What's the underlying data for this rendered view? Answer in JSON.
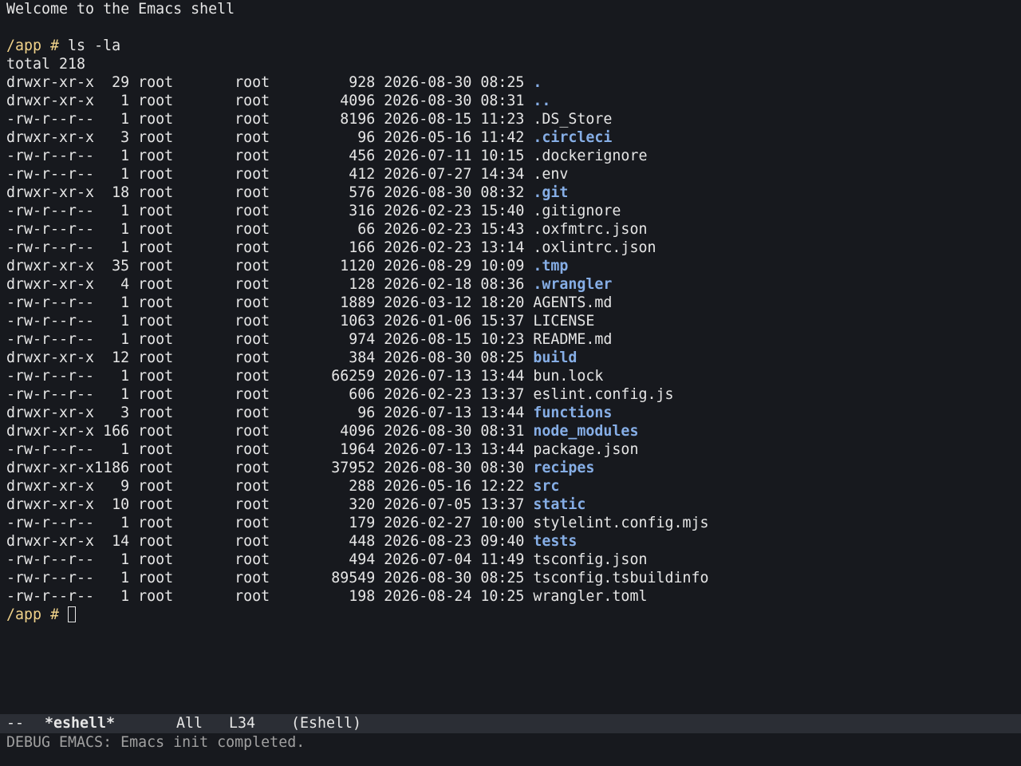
{
  "welcome": "Welcome to the Emacs shell",
  "prompt": "/app # ",
  "command": "ls -la",
  "total": "total 218",
  "entries": [
    {
      "perms": "drwxr-xr-x",
      "links": "  29",
      "owner": "root",
      "group": "root",
      "size": "928",
      "date": "2026-08-30 08:25",
      "name": ".",
      "is_dir": true
    },
    {
      "perms": "drwxr-xr-x",
      "links": "   1",
      "owner": "root",
      "group": "root",
      "size": "4096",
      "date": "2026-08-30 08:31",
      "name": "..",
      "is_dir": true
    },
    {
      "perms": "-rw-r--r--",
      "links": "   1",
      "owner": "root",
      "group": "root",
      "size": "8196",
      "date": "2026-08-15 11:23",
      "name": ".DS_Store",
      "is_dir": false
    },
    {
      "perms": "drwxr-xr-x",
      "links": "   3",
      "owner": "root",
      "group": "root",
      "size": "96",
      "date": "2026-05-16 11:42",
      "name": ".circleci",
      "is_dir": true
    },
    {
      "perms": "-rw-r--r--",
      "links": "   1",
      "owner": "root",
      "group": "root",
      "size": "456",
      "date": "2026-07-11 10:15",
      "name": ".dockerignore",
      "is_dir": false
    },
    {
      "perms": "-rw-r--r--",
      "links": "   1",
      "owner": "root",
      "group": "root",
      "size": "412",
      "date": "2026-07-27 14:34",
      "name": ".env",
      "is_dir": false
    },
    {
      "perms": "drwxr-xr-x",
      "links": "  18",
      "owner": "root",
      "group": "root",
      "size": "576",
      "date": "2026-08-30 08:32",
      "name": ".git",
      "is_dir": true
    },
    {
      "perms": "-rw-r--r--",
      "links": "   1",
      "owner": "root",
      "group": "root",
      "size": "316",
      "date": "2026-02-23 15:40",
      "name": ".gitignore",
      "is_dir": false
    },
    {
      "perms": "-rw-r--r--",
      "links": "   1",
      "owner": "root",
      "group": "root",
      "size": "66",
      "date": "2026-02-23 15:43",
      "name": ".oxfmtrc.json",
      "is_dir": false
    },
    {
      "perms": "-rw-r--r--",
      "links": "   1",
      "owner": "root",
      "group": "root",
      "size": "166",
      "date": "2026-02-23 13:14",
      "name": ".oxlintrc.json",
      "is_dir": false
    },
    {
      "perms": "drwxr-xr-x",
      "links": "  35",
      "owner": "root",
      "group": "root",
      "size": "1120",
      "date": "2026-08-29 10:09",
      "name": ".tmp",
      "is_dir": true
    },
    {
      "perms": "drwxr-xr-x",
      "links": "   4",
      "owner": "root",
      "group": "root",
      "size": "128",
      "date": "2026-02-18 08:36",
      "name": ".wrangler",
      "is_dir": true
    },
    {
      "perms": "-rw-r--r--",
      "links": "   1",
      "owner": "root",
      "group": "root",
      "size": "1889",
      "date": "2026-03-12 18:20",
      "name": "AGENTS.md",
      "is_dir": false
    },
    {
      "perms": "-rw-r--r--",
      "links": "   1",
      "owner": "root",
      "group": "root",
      "size": "1063",
      "date": "2026-01-06 15:37",
      "name": "LICENSE",
      "is_dir": false
    },
    {
      "perms": "-rw-r--r--",
      "links": "   1",
      "owner": "root",
      "group": "root",
      "size": "974",
      "date": "2026-08-15 10:23",
      "name": "README.md",
      "is_dir": false
    },
    {
      "perms": "drwxr-xr-x",
      "links": "  12",
      "owner": "root",
      "group": "root",
      "size": "384",
      "date": "2026-08-30 08:25",
      "name": "build",
      "is_dir": true
    },
    {
      "perms": "-rw-r--r--",
      "links": "   1",
      "owner": "root",
      "group": "root",
      "size": "66259",
      "date": "2026-07-13 13:44",
      "name": "bun.lock",
      "is_dir": false
    },
    {
      "perms": "-rw-r--r--",
      "links": "   1",
      "owner": "root",
      "group": "root",
      "size": "606",
      "date": "2026-02-23 13:37",
      "name": "eslint.config.js",
      "is_dir": false
    },
    {
      "perms": "drwxr-xr-x",
      "links": "   3",
      "owner": "root",
      "group": "root",
      "size": "96",
      "date": "2026-07-13 13:44",
      "name": "functions",
      "is_dir": true
    },
    {
      "perms": "drwxr-xr-x",
      "links": " 166",
      "owner": "root",
      "group": "root",
      "size": "4096",
      "date": "2026-08-30 08:31",
      "name": "node_modules",
      "is_dir": true
    },
    {
      "perms": "-rw-r--r--",
      "links": "   1",
      "owner": "root",
      "group": "root",
      "size": "1964",
      "date": "2026-07-13 13:44",
      "name": "package.json",
      "is_dir": false
    },
    {
      "perms": "drwxr-xr-x",
      "links": "1186",
      "owner": "root",
      "group": "root",
      "size": "37952",
      "date": "2026-08-30 08:30",
      "name": "recipes",
      "is_dir": true
    },
    {
      "perms": "drwxr-xr-x",
      "links": "   9",
      "owner": "root",
      "group": "root",
      "size": "288",
      "date": "2026-05-16 12:22",
      "name": "src",
      "is_dir": true
    },
    {
      "perms": "drwxr-xr-x",
      "links": "  10",
      "owner": "root",
      "group": "root",
      "size": "320",
      "date": "2026-07-05 13:37",
      "name": "static",
      "is_dir": true
    },
    {
      "perms": "-rw-r--r--",
      "links": "   1",
      "owner": "root",
      "group": "root",
      "size": "179",
      "date": "2026-02-27 10:00",
      "name": "stylelint.config.mjs",
      "is_dir": false
    },
    {
      "perms": "drwxr-xr-x",
      "links": "  14",
      "owner": "root",
      "group": "root",
      "size": "448",
      "date": "2026-08-23 09:40",
      "name": "tests",
      "is_dir": true
    },
    {
      "perms": "-rw-r--r--",
      "links": "   1",
      "owner": "root",
      "group": "root",
      "size": "494",
      "date": "2026-07-04 11:49",
      "name": "tsconfig.json",
      "is_dir": false
    },
    {
      "perms": "-rw-r--r--",
      "links": "   1",
      "owner": "root",
      "group": "root",
      "size": "89549",
      "date": "2026-08-30 08:25",
      "name": "tsconfig.tsbuildinfo",
      "is_dir": false
    },
    {
      "perms": "-rw-r--r--",
      "links": "   1",
      "owner": "root",
      "group": "root",
      "size": "198",
      "date": "2026-08-24 10:25",
      "name": "wrangler.toml",
      "is_dir": false
    }
  ],
  "modeline": {
    "status": "--",
    "buffer_name": "*eshell*",
    "position": "All",
    "line": "L34",
    "mode": "(Eshell)"
  },
  "echo_area": "DEBUG EMACS: Emacs init completed.",
  "colors": {
    "background": "#17191e",
    "prompt": "#f0d28a",
    "directory": "#86aee6",
    "modeline_bg": "#2b2e35"
  }
}
